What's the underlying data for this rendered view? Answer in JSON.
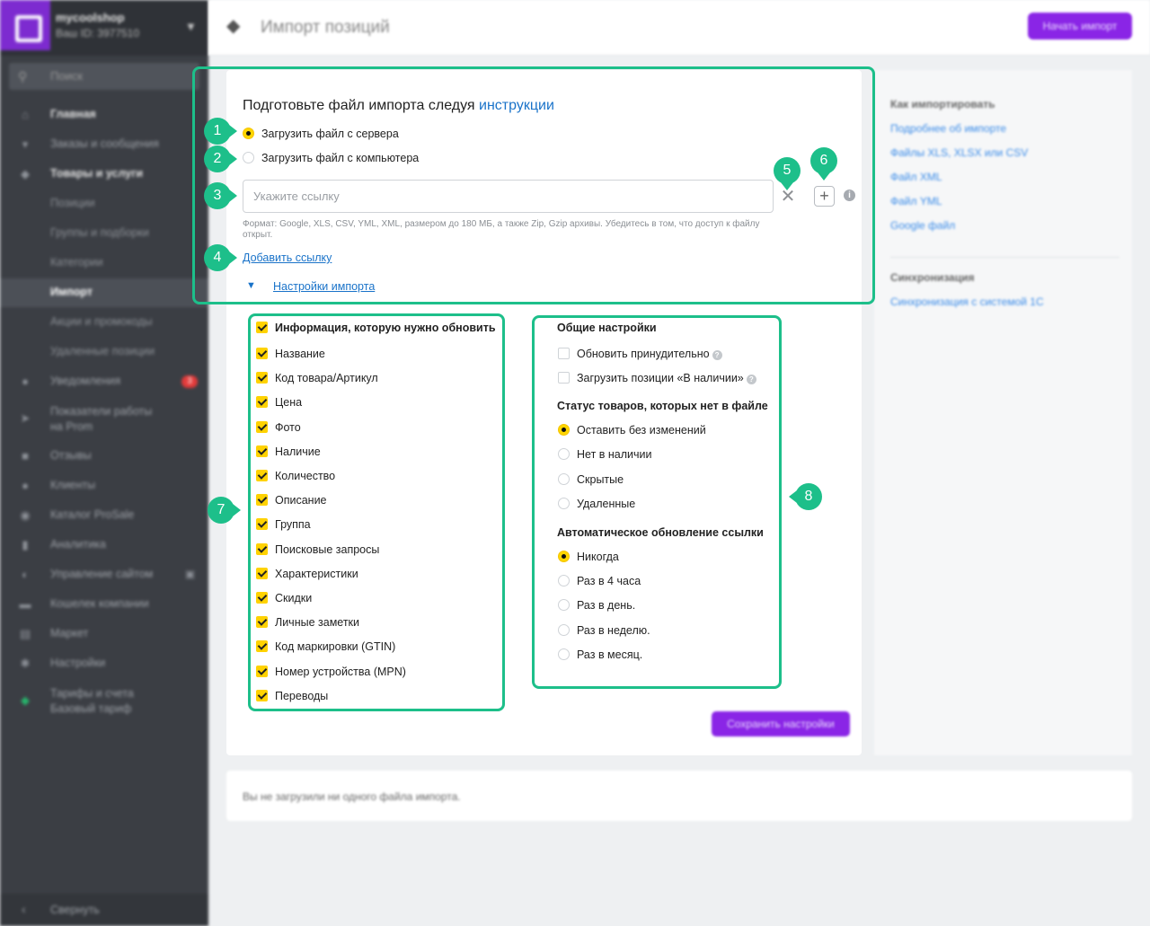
{
  "sidebar": {
    "shop_name": "mycoolshop",
    "shop_id": "Ваш ID: 3977510",
    "search_label": "Поиск",
    "items": [
      {
        "label": "Главная",
        "icon": "home-icon"
      },
      {
        "label": "Заказы и сообщения",
        "icon": "cart-icon"
      },
      {
        "label": "Товары и услуги",
        "icon": "tag-icon"
      },
      {
        "label": "Позиции"
      },
      {
        "label": "Группы и подборки"
      },
      {
        "label": "Категории"
      },
      {
        "label": "Импорт"
      },
      {
        "label": "Акции и промокоды"
      },
      {
        "label": "Удаленные позиции"
      },
      {
        "label": "Уведомления",
        "icon": "bell-icon",
        "badge": "3"
      },
      {
        "label": "Показатели работы на Prom",
        "icon": "rocket-icon"
      },
      {
        "label": "Отзывы",
        "icon": "chat-icon"
      },
      {
        "label": "Клиенты",
        "icon": "users-icon"
      },
      {
        "label": "Каталог ProSale",
        "icon": "globe-icon"
      },
      {
        "label": "Аналитика",
        "icon": "bar-chart-icon"
      },
      {
        "label": "Управление сайтом",
        "icon": "palette-icon"
      },
      {
        "label": "Кошелек компании",
        "icon": "wallet-icon"
      },
      {
        "label": "Маркет",
        "icon": "store-icon"
      },
      {
        "label": "Настройки",
        "icon": "gear-icon"
      },
      {
        "label": "Тарифы и счета Базовый тариф",
        "icon": "leaf-icon"
      }
    ],
    "collapse_label": "Свернуть"
  },
  "header": {
    "title": "Импорт позиций",
    "start_button": "Начать импорт"
  },
  "import_form": {
    "prepare_text": "Подготовьте файл импорта следуя ",
    "instructions_link": "инструкции",
    "source_options": [
      "Загрузить файл с сервера",
      "Загрузить файл с компьютера"
    ],
    "selected_source": "Загрузить файл с сервера",
    "url_placeholder": "Укажите ссылку",
    "url_value": "",
    "format_hint": "Формат: Google, XLS, CSV, YML, XML, размером до 180 МБ, а также Zip, Gzip архивы. Убедитесь в том, что доступ к файлу открыт.",
    "add_link": "Добавить ссылку",
    "settings_link": "Настройки импорта",
    "info_icon_glyph": "i"
  },
  "update_info": {
    "title": "Информация, которую нужно обновить",
    "items": [
      {
        "label": "Название",
        "checked": true
      },
      {
        "label": "Код товара/Артикул",
        "checked": true
      },
      {
        "label": "Цена",
        "checked": true
      },
      {
        "label": "Фото",
        "checked": true
      },
      {
        "label": "Наличие",
        "checked": true
      },
      {
        "label": "Количество",
        "checked": true
      },
      {
        "label": "Описание",
        "checked": true
      },
      {
        "label": "Группа",
        "checked": true
      },
      {
        "label": "Поисковые запросы",
        "checked": true
      },
      {
        "label": "Характеристики",
        "checked": true
      },
      {
        "label": "Скидки",
        "checked": true
      },
      {
        "label": "Личные заметки",
        "checked": true
      },
      {
        "label": "Код маркировки (GTIN)",
        "checked": true
      },
      {
        "label": "Номер устройства (MPN)",
        "checked": true
      },
      {
        "label": "Переводы",
        "checked": true
      }
    ]
  },
  "general_settings": {
    "title": "Общие настройки",
    "options": [
      {
        "label": "Обновить принудительно",
        "checked": false
      },
      {
        "label": "Загрузить позиции «В наличии»",
        "checked": false
      }
    ],
    "missing_status_title": "Статус товаров, которых нет в файле",
    "missing_status_options": [
      "Оставить без изменений",
      "Нет в наличии",
      "Скрытые",
      "Удаленные"
    ],
    "missing_status_selected": "Оставить без изменений",
    "auto_update_title": "Автоматическое обновление ссылки",
    "auto_update_options": [
      "Никогда",
      "Раз в 4 часа",
      "Раз в день.",
      "Раз в неделю.",
      "Раз в месяц."
    ],
    "auto_update_selected": "Никогда",
    "help_glyph": "?"
  },
  "save_button": "Сохранить настройки",
  "help_sidebar": {
    "how_title": "Как импортировать",
    "how_links": [
      "Подробнее об импорте",
      "Файлы XLS, XLSX или CSV",
      "Файл XML",
      "Файл YML",
      "Google файл"
    ],
    "sync_title": "Синхронизация",
    "sync_links": [
      "Синхронизация с системой 1С"
    ]
  },
  "status_message": "Вы не загрузили ни одного файла импорта.",
  "annotations": [
    "1",
    "2",
    "3",
    "4",
    "5",
    "6",
    "7",
    "8"
  ],
  "colors": {
    "accent_purple": "#8a25e6",
    "annotation_green": "#1dbf8a",
    "checkbox_yellow": "#ffd200",
    "link_blue": "#1a73c9",
    "sidebar_bg": "#3b3e44"
  }
}
